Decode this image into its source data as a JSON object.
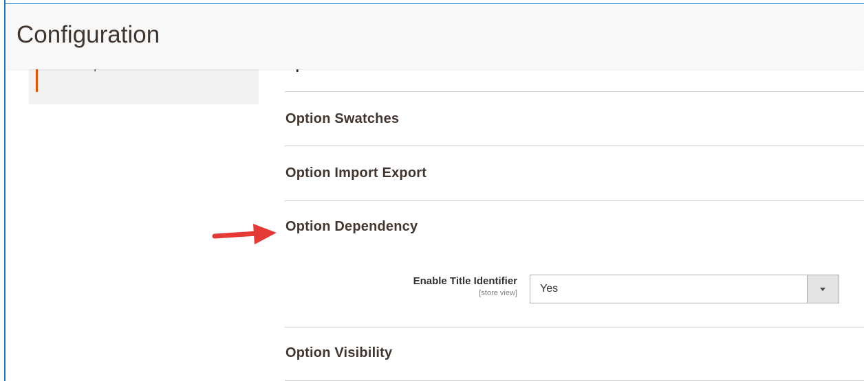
{
  "header": {
    "title": "Configuration"
  },
  "sidebar": {
    "active_item": "Custom Options"
  },
  "sections": {
    "cut_off_label": "Option Features",
    "option_swatches": "Option Swatches",
    "option_import_export": "Option Import Export",
    "option_dependency": "Option Dependency",
    "option_visibility": "Option Visibility"
  },
  "dependency_field": {
    "label": "Enable Title Identifier",
    "scope": "[store view]",
    "value": "Yes"
  },
  "colors": {
    "accent_orange": "#eb5202",
    "arrow_red": "#e53935",
    "frame_blue": "#1979c3"
  }
}
